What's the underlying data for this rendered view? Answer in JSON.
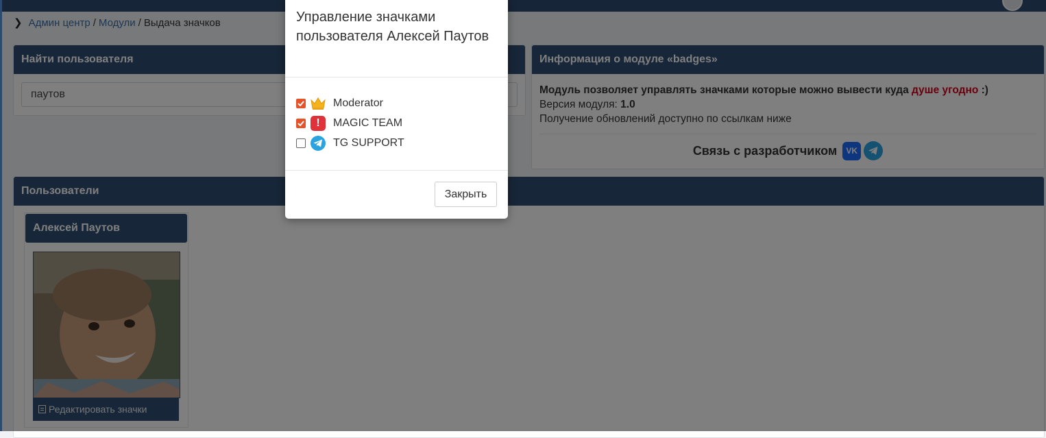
{
  "breadcrumb": {
    "items": [
      "Админ центр",
      "Модули"
    ],
    "separator": "/",
    "current": "Выдача значков"
  },
  "search": {
    "title": "Найти пользователя",
    "value": "паутов"
  },
  "info": {
    "title": "Информация о модуле «badges»",
    "desc_prefix": "Модуль позволяет управлять значками которые можно вывести куда ",
    "desc_highlight": "душе угодно",
    "desc_suffix": " :)",
    "version_label": "Версия модуля: ",
    "version_value": "1.0",
    "updates_text": "Получение обновлений доступно по ссылкам ниже",
    "contact_label": "Связь с разработчиком",
    "vk_label": "VK"
  },
  "users": {
    "title": "Пользователи",
    "cards": [
      {
        "name": "Алексей Паутов",
        "edit_label": "Редактировать значки"
      }
    ]
  },
  "modal": {
    "title": "Управление значками пользователя Алексей Паутов",
    "badges": [
      {
        "label": "Moderator",
        "checked": true,
        "icon": "crown-icon"
      },
      {
        "label": "MAGIC TEAM",
        "checked": true,
        "icon": "exclamation-icon"
      },
      {
        "label": "TG SUPPORT",
        "checked": false,
        "icon": "telegram-icon"
      }
    ],
    "close_label": "Закрыть"
  },
  "colors": {
    "header": "#2f4d70",
    "link": "#3a6ea5",
    "highlight": "#d0021b",
    "checkbox": "#e5532b"
  }
}
